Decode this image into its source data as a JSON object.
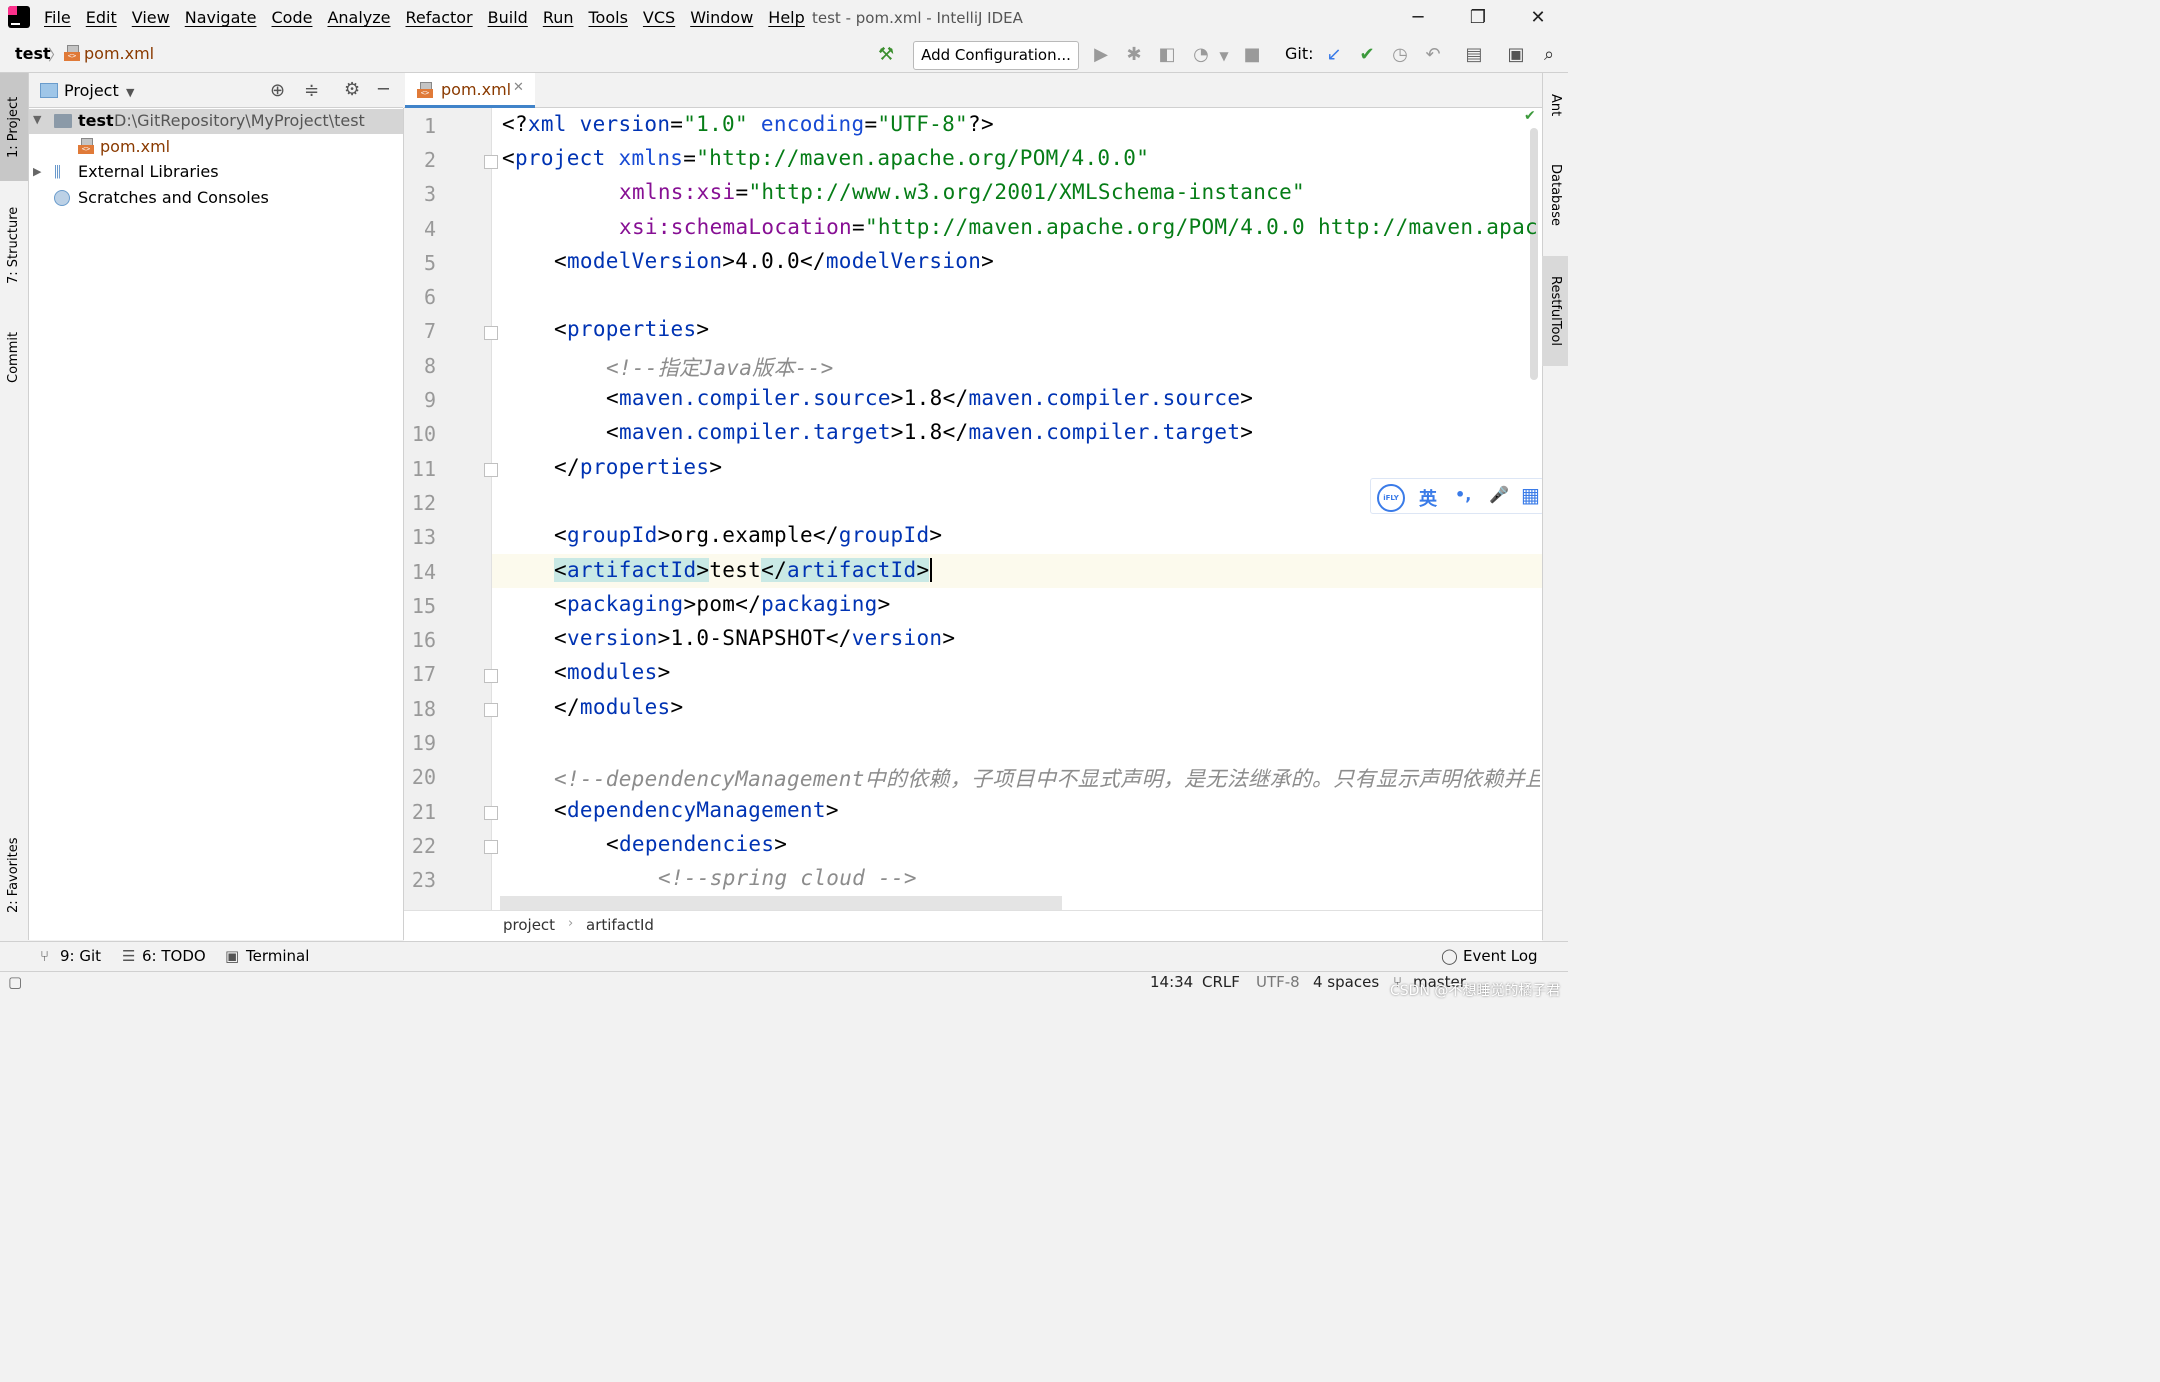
{
  "window": {
    "menu": [
      "File",
      "Edit",
      "View",
      "Navigate",
      "Code",
      "Analyze",
      "Refactor",
      "Build",
      "Run",
      "Tools",
      "VCS",
      "Window",
      "Help"
    ],
    "title": "test - pom.xml - IntelliJ IDEA",
    "min": "─",
    "max": "❐",
    "close": "✕"
  },
  "navbar": {
    "project": "test",
    "sep": "〉",
    "file": "pom.xml",
    "add_configuration": "Add Configuration...",
    "git_label": "Git:"
  },
  "left_tabs": {
    "project": "1: Project",
    "structure": "7: Structure",
    "commit": "Commit",
    "favorites": "2: Favorites"
  },
  "project_panel": {
    "title": "Project",
    "tree": [
      {
        "name": "test",
        "path": "D:\\GitRepository\\MyProject\\test"
      },
      {
        "name": "pom.xml"
      },
      {
        "name": "External Libraries"
      },
      {
        "name": "Scratches and Consoles"
      }
    ]
  },
  "editor": {
    "tab": "pom.xml",
    "line_numbers": [
      "1",
      "2",
      "3",
      "4",
      "5",
      "6",
      "7",
      "8",
      "9",
      "10",
      "11",
      "12",
      "13",
      "14",
      "15",
      "16",
      "17",
      "18",
      "19",
      "20",
      "21",
      "22",
      "23"
    ],
    "breadcrumb": [
      "project",
      "artifactId"
    ],
    "code": {
      "l1_a": "<?",
      "l1_b": "xml version",
      "l1_c": "=",
      "l1_d": "\"1.0\"",
      "l1_e": "encoding",
      "l1_f": "\"UTF-8\"",
      "l1_g": "?>",
      "l2_tag": "project",
      "l2_attr": "xmlns",
      "l2_val": "\"http://maven.apache.org/POM/4.0.0\"",
      "l3_ns": "xmlns:xsi",
      "l3_val": "\"http://www.w3.org/2001/XMLSchema-instance\"",
      "l4_ns": "xsi:schemaLocation",
      "l4_val": "\"http://maven.apache.org/POM/4.0.0 http://maven.apac",
      "l5_tag": "modelVersion",
      "l5_text": "4.0.0",
      "l7_tag": "properties",
      "l8_cmt": "<!--指定Java版本-->",
      "l9_tag": "maven.compiler.source",
      "l9_text": "1.8",
      "l10_tag": "maven.compiler.target",
      "l10_text": "1.8",
      "l13_tag": "groupId",
      "l13_text": "org.example",
      "l14_tag": "artifactId",
      "l14_text": "test",
      "l15_tag": "packaging",
      "l15_text": "pom",
      "l16_tag": "version",
      "l16_text": "1.0-SNAPSHOT",
      "l17_tag": "modules",
      "l20_cmt": "<!--dependencyManagement中的依赖，子项目中不显式声明，是无法继承的。只有显示声明依赖并且",
      "l21_tag": "dependencyManagement",
      "l22_tag": "dependencies",
      "l23_cmt": "<!--spring cloud -->"
    }
  },
  "right_tabs": {
    "ant": "Ant",
    "database": "Database",
    "restful": "RestfulTool"
  },
  "ifly": {
    "logo": "iFLY",
    "lang": "英",
    "punct": "•,",
    "mic": "🎤",
    "apps": "▦"
  },
  "bottom_tools": {
    "git": "9: Git",
    "todo": "6: TODO",
    "terminal": "Terminal",
    "event_log": "Event Log"
  },
  "status": {
    "pos": "14:34",
    "line_sep": "CRLF",
    "encoding": "UTF-8",
    "indent": "4 spaces",
    "branch": "master"
  },
  "watermark": "CSDN @不想睡觉的橘子君",
  "colors": {
    "tag": "#0033b3",
    "attr": "#174ad4",
    "ns": "#871094",
    "value": "#067d17",
    "comment": "#8c8c8c",
    "accent": "#4083c9"
  }
}
